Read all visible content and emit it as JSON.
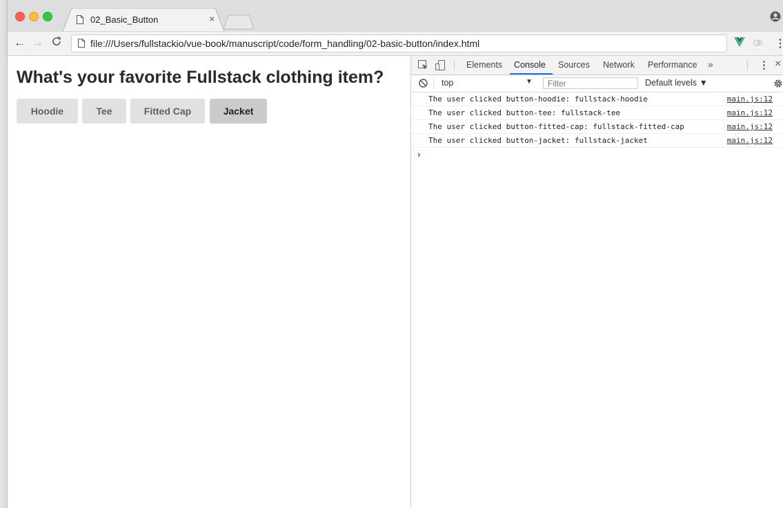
{
  "browser": {
    "tab_title": "02_Basic_Button",
    "tab_close": "×",
    "url": "file:///Users/fullstackio/vue-book/manuscript/code/form_handling/02-basic-button/index.html",
    "nav_back": "←",
    "nav_forward": "→",
    "nav_reload": "C",
    "menu": "⋮"
  },
  "page": {
    "heading": "What's your favorite Fullstack clothing item?",
    "buttons": [
      {
        "label": "Hoodie",
        "active": false
      },
      {
        "label": "Tee",
        "active": false
      },
      {
        "label": "Fitted Cap",
        "active": false
      },
      {
        "label": "Jacket",
        "active": true
      }
    ]
  },
  "devtools": {
    "tabs": [
      "Elements",
      "Console",
      "Sources",
      "Network",
      "Performance"
    ],
    "active_tab": "Console",
    "more": "»",
    "kebab": "⋮",
    "close": "×",
    "context": "top",
    "context_caret": "▼",
    "filter_placeholder": "Filter",
    "levels": "Default levels ▼",
    "logs": [
      {
        "message": "The user clicked button-hoodie: fullstack-hoodie",
        "source": "main.js:12"
      },
      {
        "message": "The user clicked button-tee: fullstack-tee",
        "source": "main.js:12"
      },
      {
        "message": "The user clicked button-fitted-cap: fullstack-fitted-cap",
        "source": "main.js:12"
      },
      {
        "message": "The user clicked button-jacket: fullstack-jacket",
        "source": "main.js:12"
      }
    ],
    "prompt": "›"
  },
  "colors": {
    "button_bg": "#e0e1e2",
    "button_active_bg": "#cacbcd",
    "devtools_accent": "#1a73e8",
    "vue_green": "#41b883"
  }
}
